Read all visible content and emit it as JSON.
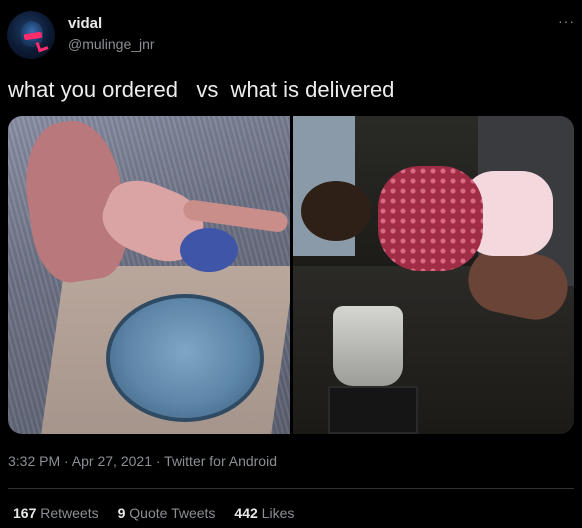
{
  "tweet": {
    "author": {
      "name": "vidal",
      "handle": "@mulinge_jnr",
      "avatar_icon": "avatar-image"
    },
    "more_icon": "more-icon",
    "text": "what you ordered   vs  what is delivered",
    "media": {
      "left_image": "photo-left",
      "right_image": "photo-right"
    },
    "meta": "3:32 PM · Apr 27, 2021 · Twitter for Android",
    "stats": {
      "retweets_count": "167",
      "retweets_label": " Retweets",
      "quote_count": "9",
      "quote_label": " Quote Tweets",
      "likes_count": "442",
      "likes_label": " Likes"
    }
  },
  "colors": {
    "background": "#000000",
    "text_primary": "#e7e9ea",
    "text_secondary": "#8b8f94",
    "divider": "#2f3336"
  }
}
